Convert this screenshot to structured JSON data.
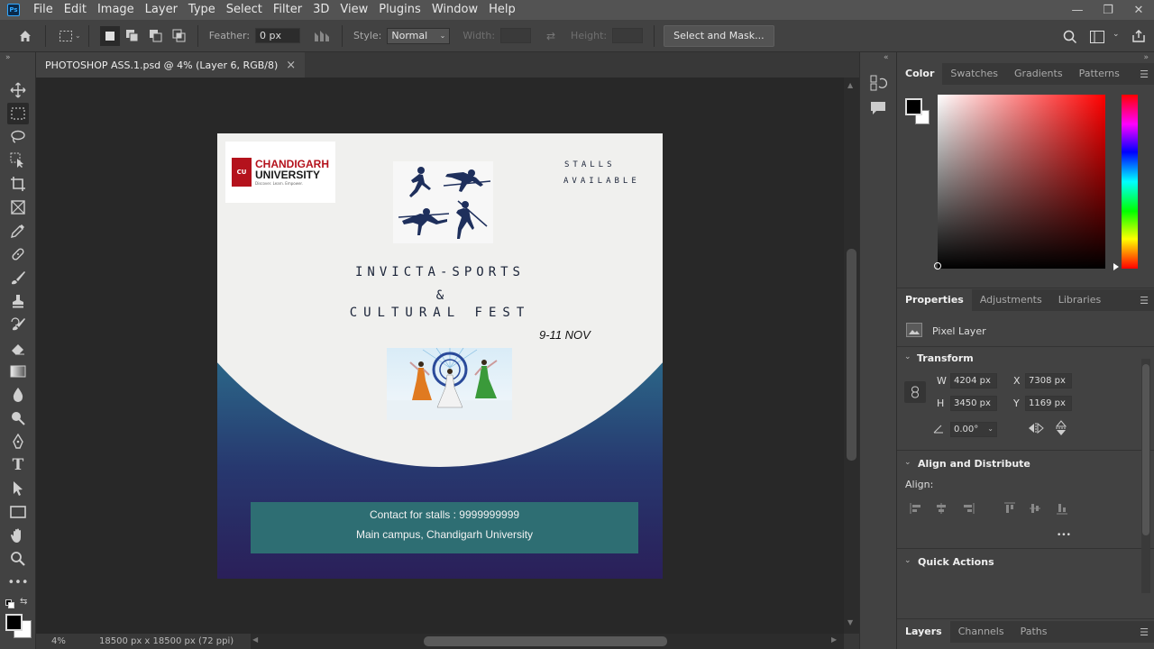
{
  "app": {
    "logo": "Ps"
  },
  "menu": [
    "File",
    "Edit",
    "Image",
    "Layer",
    "Type",
    "Select",
    "Filter",
    "3D",
    "View",
    "Plugins",
    "Window",
    "Help"
  ],
  "window_controls": {
    "minimize": "—",
    "restore": "❐",
    "close": "✕"
  },
  "options": {
    "feather_label": "Feather:",
    "feather_value": "0 px",
    "style_label": "Style:",
    "style_value": "Normal",
    "width_label": "Width:",
    "height_label": "Height:",
    "select_mask_label": "Select and Mask..."
  },
  "document": {
    "tab_title": "PHOTOSHOP ASS.1.psd @ 4% (Layer 6, RGB/8)",
    "tab_close": "×",
    "zoom": "4%",
    "dimensions": "18500 px x 18500 px (72 ppi)",
    "status_arrow": "〉"
  },
  "poster": {
    "university_name_1": "CHANDIGARH",
    "university_name_2": "UNIVERSITY",
    "university_tagline": "Discover. Learn. Empower.",
    "cu_mark": "CU",
    "stalls_1": "STALLS",
    "stalls_2": "AVAILABLE",
    "title_1": "INVICTA-SPORTS",
    "title_amp": "&",
    "title_2": "CULTURAL FEST",
    "dates": "9-11 NOV",
    "contact": "Contact for stalls : 9999999999",
    "venue": "Main campus, Chandigarh University"
  },
  "color_panel": {
    "tabs": [
      "Color",
      "Swatches",
      "Gradients",
      "Patterns"
    ],
    "foreground": "#000000",
    "background": "#ffffff",
    "hue_base": "#ff0000"
  },
  "properties_panel": {
    "tabs": [
      "Properties",
      "Adjustments",
      "Libraries"
    ],
    "layer_type": "Pixel Layer",
    "transform_title": "Transform",
    "w_label": "W",
    "w_value": "4204 px",
    "h_label": "H",
    "h_value": "3450 px",
    "x_label": "X",
    "x_value": "7308 px",
    "y_label": "Y",
    "y_value": "1169 px",
    "angle_value": "0.00°",
    "align_title": "Align and Distribute",
    "align_label": "Align:",
    "more": "•••",
    "quick_actions_title": "Quick Actions"
  },
  "layers_panel": {
    "tabs": [
      "Layers",
      "Channels",
      "Paths"
    ]
  }
}
